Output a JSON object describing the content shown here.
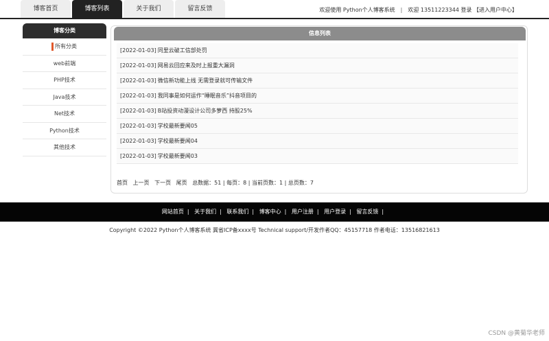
{
  "nav": {
    "tabs": [
      {
        "label": "博客首页",
        "active": false
      },
      {
        "label": "博客列表",
        "active": true
      },
      {
        "label": "关于我们",
        "active": false
      },
      {
        "label": "留言反馈",
        "active": false
      }
    ],
    "welcome": "欢迎使用 Python个人博客系统",
    "user": "欢迎 13511223344 登录 【进入用户中心】"
  },
  "sidebar": {
    "title": "博客分类",
    "items": [
      "所有分类",
      "web前端",
      "PHP技术",
      "Java技术",
      "Net技术",
      "Python技术",
      "其他技术"
    ]
  },
  "main": {
    "title": "信息列表",
    "rows": [
      {
        "date": "[2022-01-03]",
        "title": "同里云破工信部处罚"
      },
      {
        "date": "[2022-01-03]",
        "title": "网易云回应来及时上报重大漏洞"
      },
      {
        "date": "[2022-01-03]",
        "title": "微信新功能上线 无需登录就可传输文件"
      },
      {
        "date": "[2022-01-03]",
        "title": "我同事是如何运作“睡眠音乐”抖音项目的"
      },
      {
        "date": "[2022-01-03]",
        "title": "B站投资动漫设计公司多萝西 持股25%"
      },
      {
        "date": "[2022-01-03]",
        "title": "学校最新要闻05"
      },
      {
        "date": "[2022-01-03]",
        "title": "学校最新要闻04"
      },
      {
        "date": "[2022-01-03]",
        "title": "学校最新要闻03"
      }
    ],
    "pager": {
      "first": "首页",
      "prev": "上一页",
      "next": "下一页",
      "last": "尾页",
      "summary": "总数据：51 | 每页：8 | 当前页数：1 | 总页数：7"
    }
  },
  "footer": {
    "links": [
      "网站首页",
      "关于我们",
      "联系我们",
      "博客中心",
      "用户注册",
      "用户登录",
      "留言反馈"
    ],
    "copyright": "Copyright ©2022 Python个人博客系统 冀省ICP备xxxx号    Technical support/开发作者QQ：45157718    作者电话：13516821613"
  },
  "watermark": "CSDN @黄菊华老师"
}
